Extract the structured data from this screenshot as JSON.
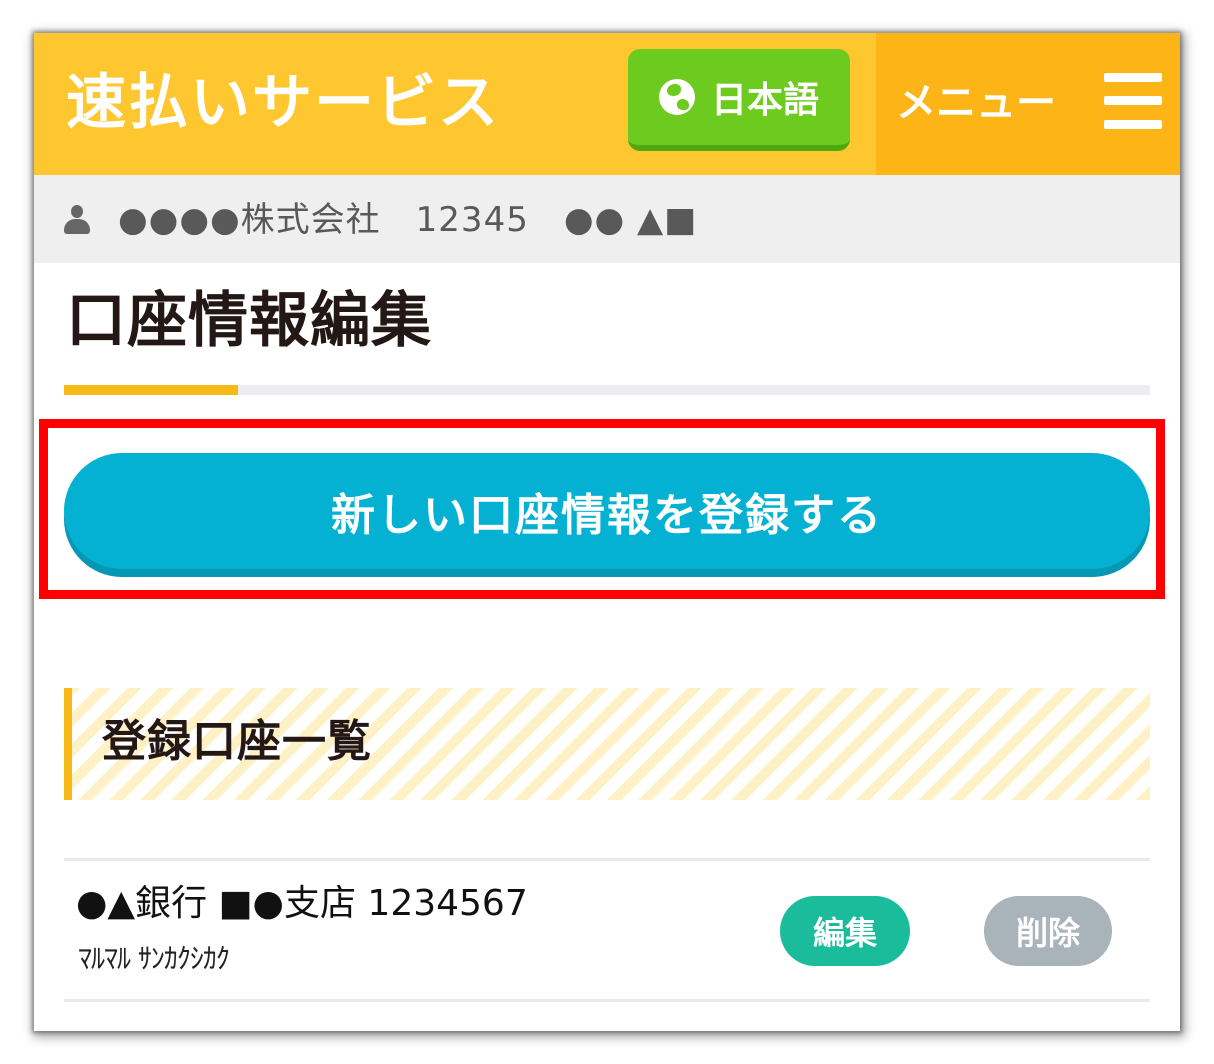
{
  "header": {
    "title": "速払いサービス",
    "language_label": "日本語",
    "menu_label": "メニュー",
    "language_icon": "globe-icon",
    "menu_icon": "hamburger-icon"
  },
  "user_bar": {
    "icon": "user-icon",
    "text": "●●●●株式会社　12345　●● ▲■"
  },
  "page": {
    "title": "口座情報編集",
    "progress_fraction": 0.16
  },
  "register_button_label": "新しい口座情報を登録する",
  "account_list": {
    "heading": "登録口座一覧",
    "items": [
      {
        "bank_info": "●▲銀行 ■●支店 1234567",
        "holder_kana": "ﾏﾙﾏﾙ ｻﾝｶｸｼｶｸ",
        "edit_label": "編集",
        "delete_label": "削除"
      }
    ]
  },
  "colors": {
    "header_bg": "#fec62f",
    "menu_bg": "#fdb416",
    "language_button": "#6dcb1f",
    "register_button": "#05b1d2",
    "highlight_border": "#fe0000",
    "edit_button": "#1bbc9b",
    "delete_button": "#a8b3ba",
    "accent": "#f6b917"
  }
}
